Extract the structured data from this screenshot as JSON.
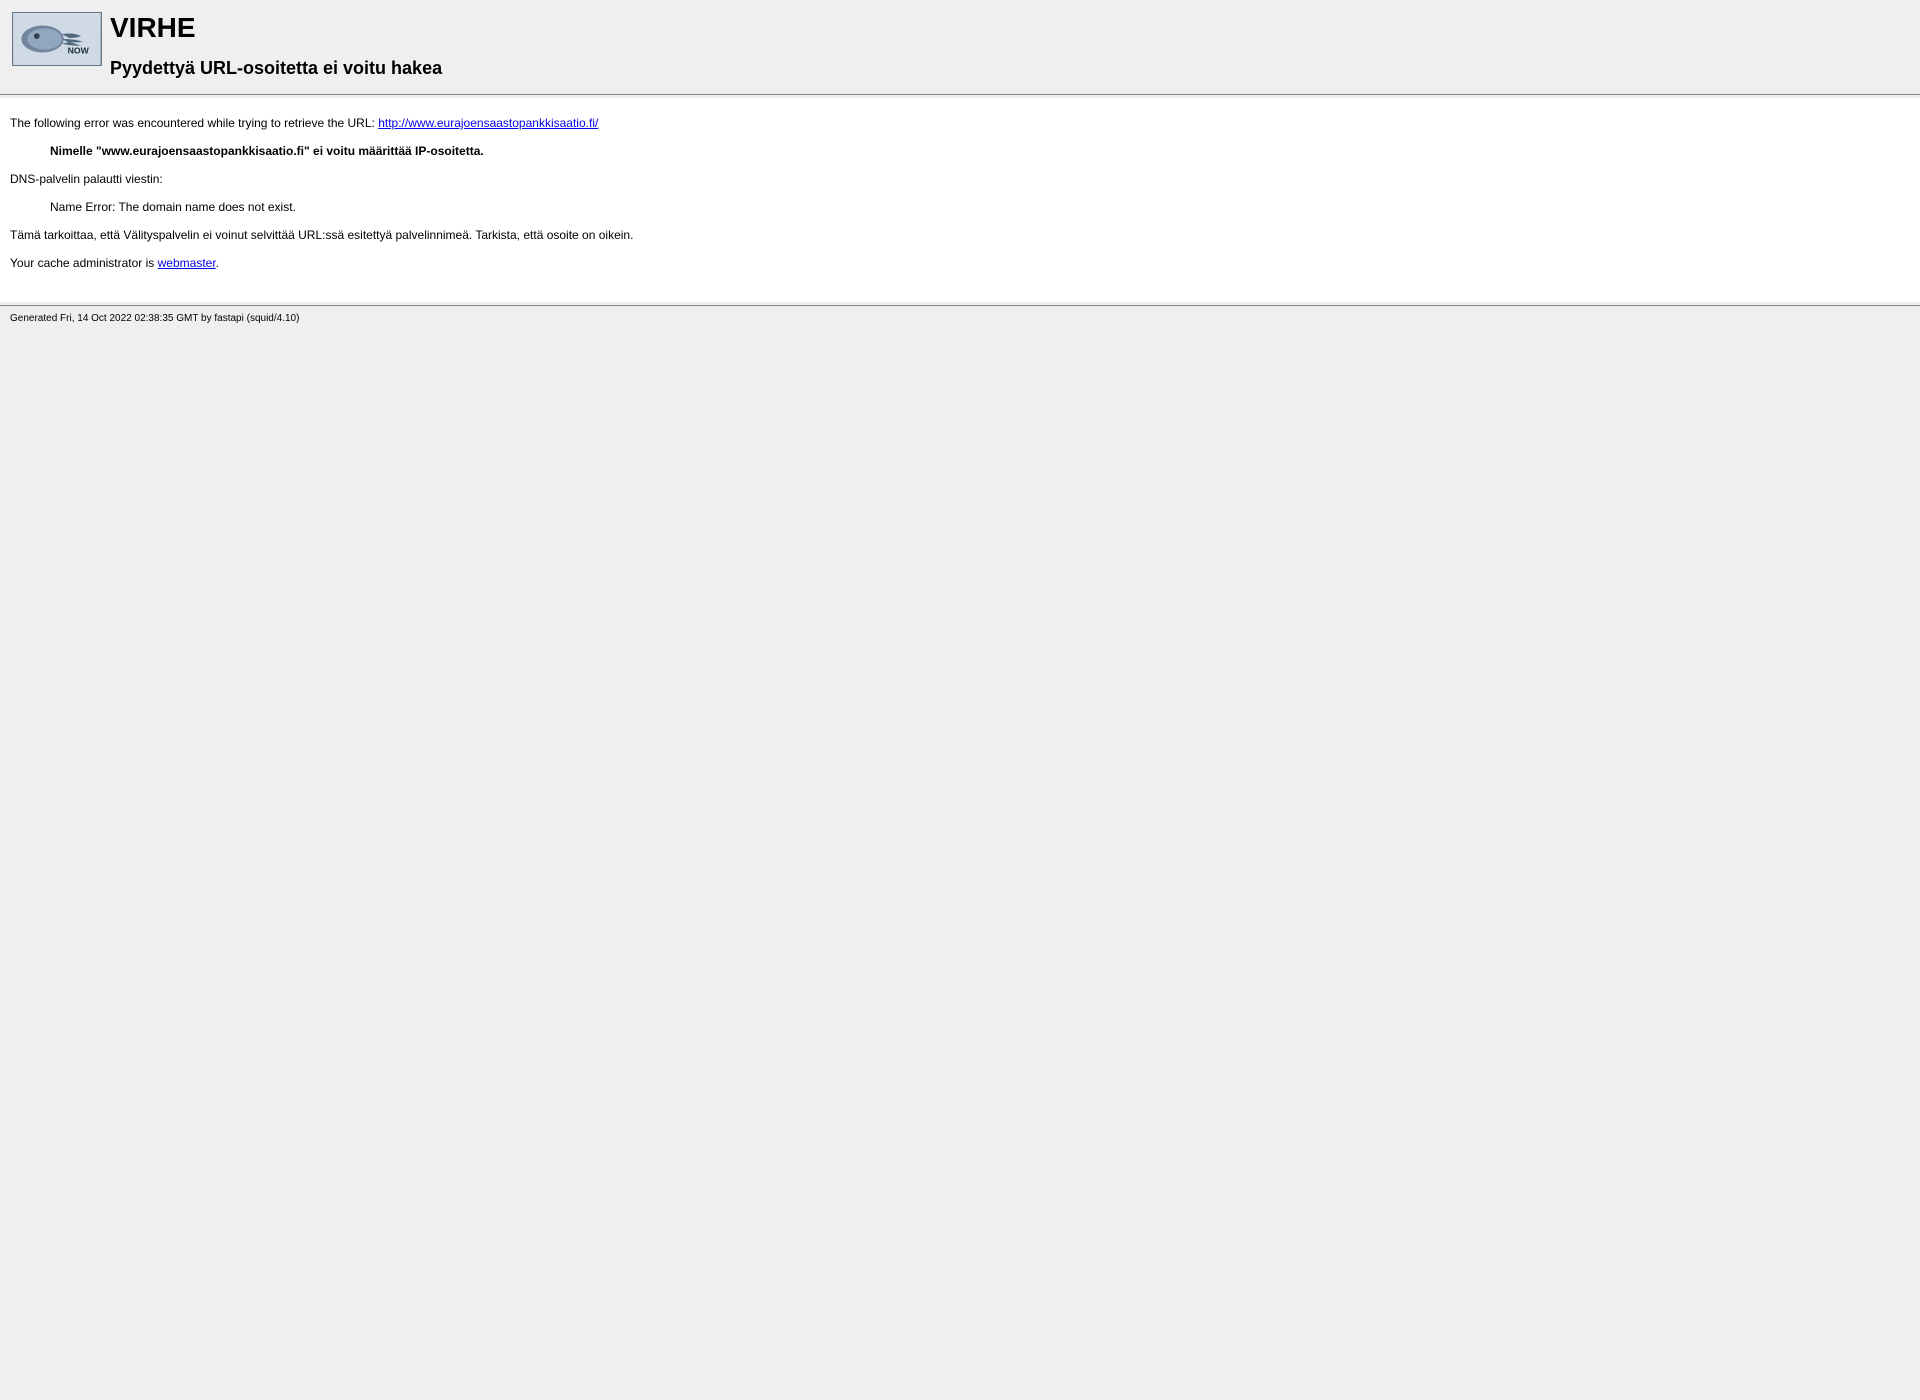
{
  "header": {
    "title": "VIRHE",
    "subtitle": "Pyydettyä URL-osoitetta ei voitu hakea"
  },
  "content": {
    "intro_text": "The following error was encountered while trying to retrieve the URL: ",
    "intro_url": "http://www.eurajoensaastopankkisaatio.fi/",
    "error_detail": "Nimelle \"www.eurajoensaastopankkisaatio.fi\" ei voitu määrittää IP-osoitetta.",
    "dns_label": "DNS-palvelin palautti viestin:",
    "dns_error": "Name Error: The domain name does not exist.",
    "explanation": "Tämä tarkoittaa, että Välityspalvelin ei voinut selvittää URL:ssä esitettyä palvelinnimeä. Tarkista, että osoite on oikein.",
    "admin_text": "Your cache administrator is ",
    "admin_link": "webmaster",
    "admin_period": "."
  },
  "footer": {
    "generated": "Generated Fri, 14 Oct 2022 02:38:35 GMT by fastapi (squid/4.10)"
  }
}
